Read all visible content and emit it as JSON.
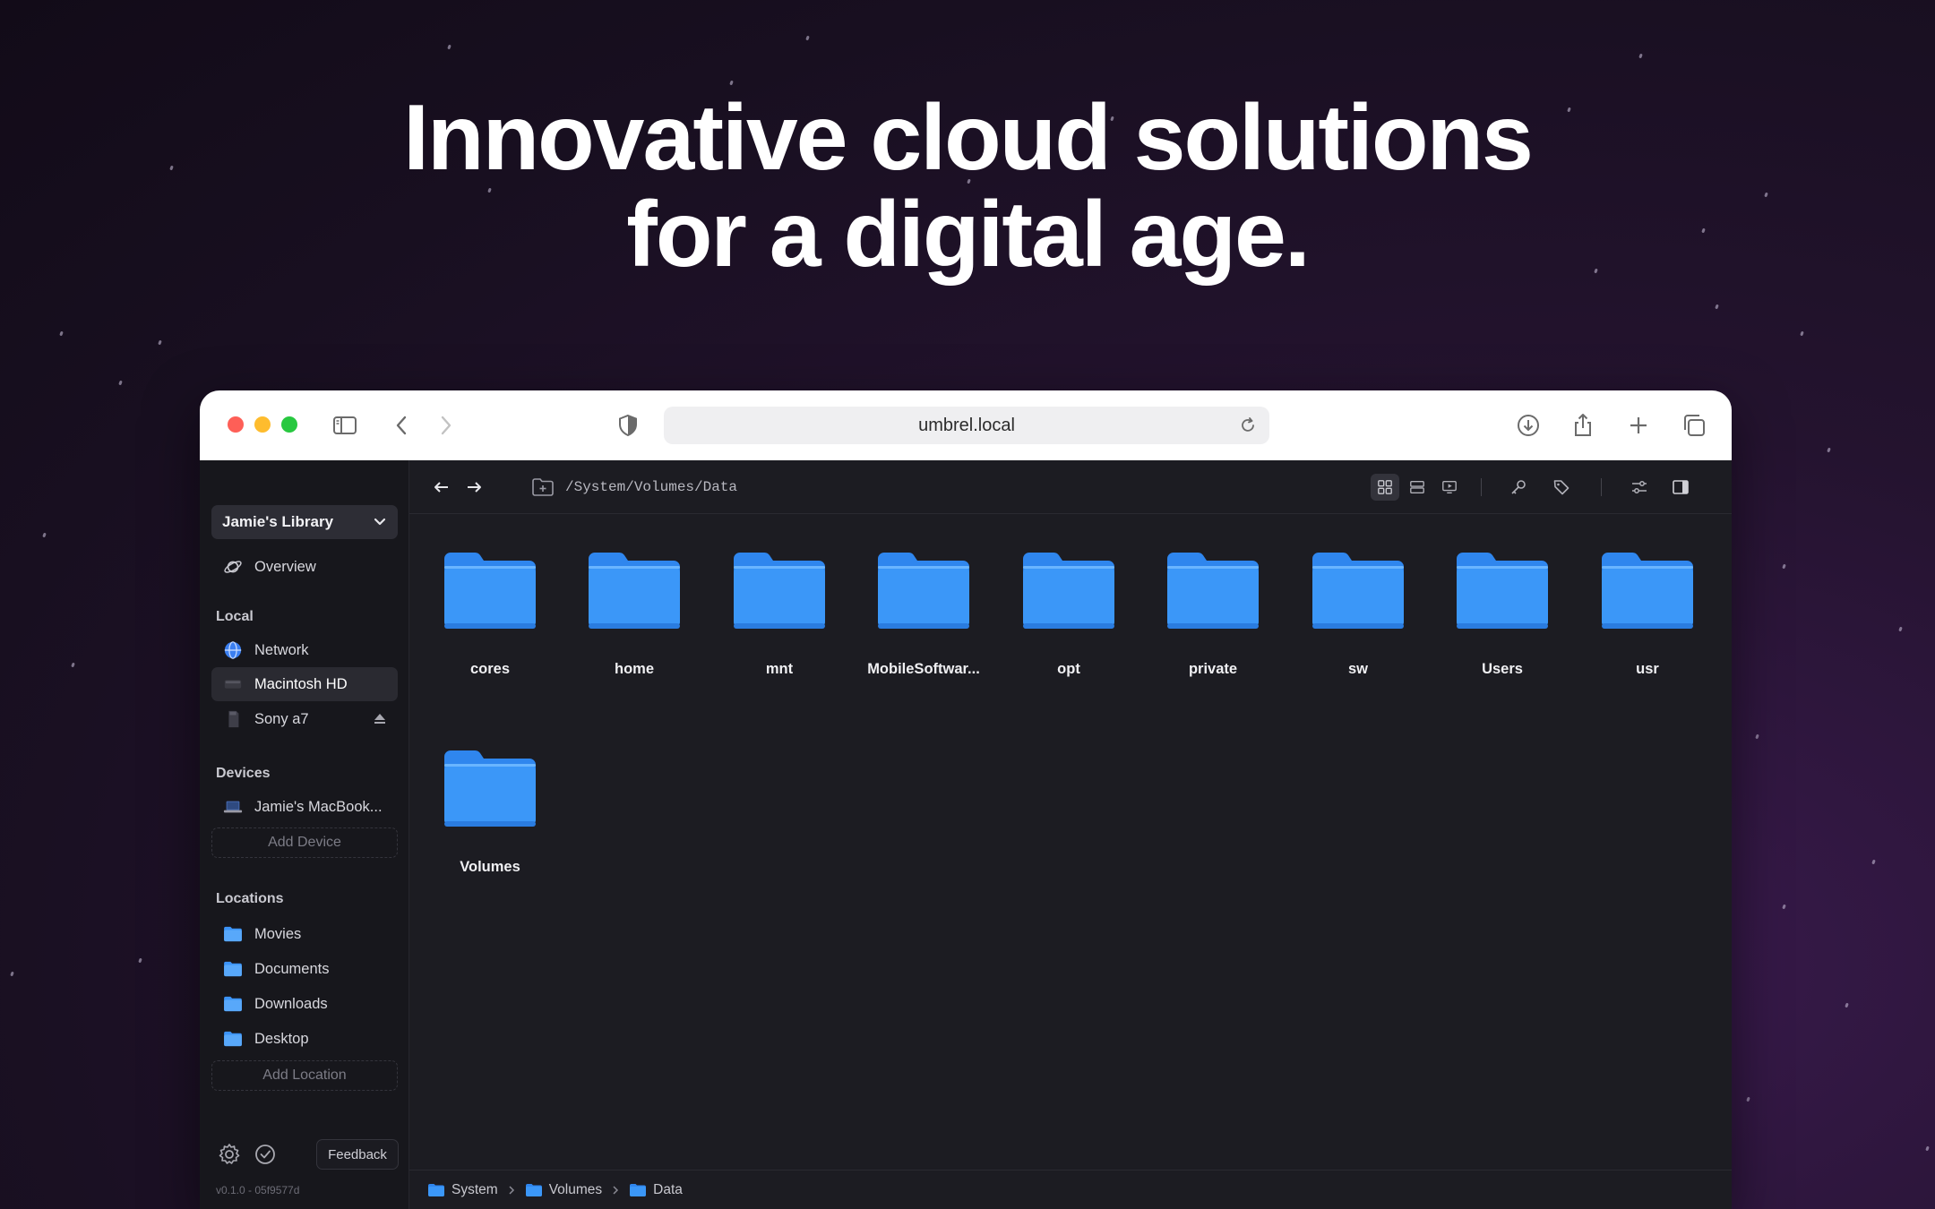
{
  "headline": {
    "line1": "Innovative cloud solutions",
    "line2": "for a digital age."
  },
  "browser": {
    "url": "umbrel.local",
    "icons": [
      "sidebar-toggle-icon",
      "back-chevron-icon",
      "forward-chevron-icon",
      "shield-icon",
      "reload-icon",
      "download-icon",
      "share-icon",
      "plus-icon",
      "tabs-icon"
    ]
  },
  "sidebar": {
    "library": "Jamie's Library",
    "overview": "Overview",
    "local_heading": "Local",
    "local_items": [
      {
        "label": "Network"
      },
      {
        "label": "Macintosh HD"
      },
      {
        "label": "Sony a7"
      }
    ],
    "devices_heading": "Devices",
    "device_item": "Jamie's MacBook...",
    "add_device": "Add Device",
    "locations_heading": "Locations",
    "locations": [
      {
        "label": "Movies"
      },
      {
        "label": "Documents"
      },
      {
        "label": "Downloads"
      },
      {
        "label": "Desktop"
      }
    ],
    "add_location": "Add Location",
    "feedback": "Feedback",
    "version": "v0.1.0 - 05f9577d"
  },
  "toolbar": {
    "path": "/System/Volumes/Data"
  },
  "folders": [
    {
      "name": "cores"
    },
    {
      "name": "home"
    },
    {
      "name": "mnt"
    },
    {
      "name": "MobileSoftwar..."
    },
    {
      "name": "opt"
    },
    {
      "name": "private"
    },
    {
      "name": "sw"
    },
    {
      "name": "Users"
    },
    {
      "name": "usr"
    },
    {
      "name": "Volumes"
    }
  ],
  "breadcrumb": [
    "System",
    "Volumes",
    "Data"
  ],
  "colors": {
    "folder_blue": "#3b93f7",
    "accent_red": "#fe5f57",
    "accent_yellow": "#febc2e",
    "accent_green": "#28c840"
  }
}
